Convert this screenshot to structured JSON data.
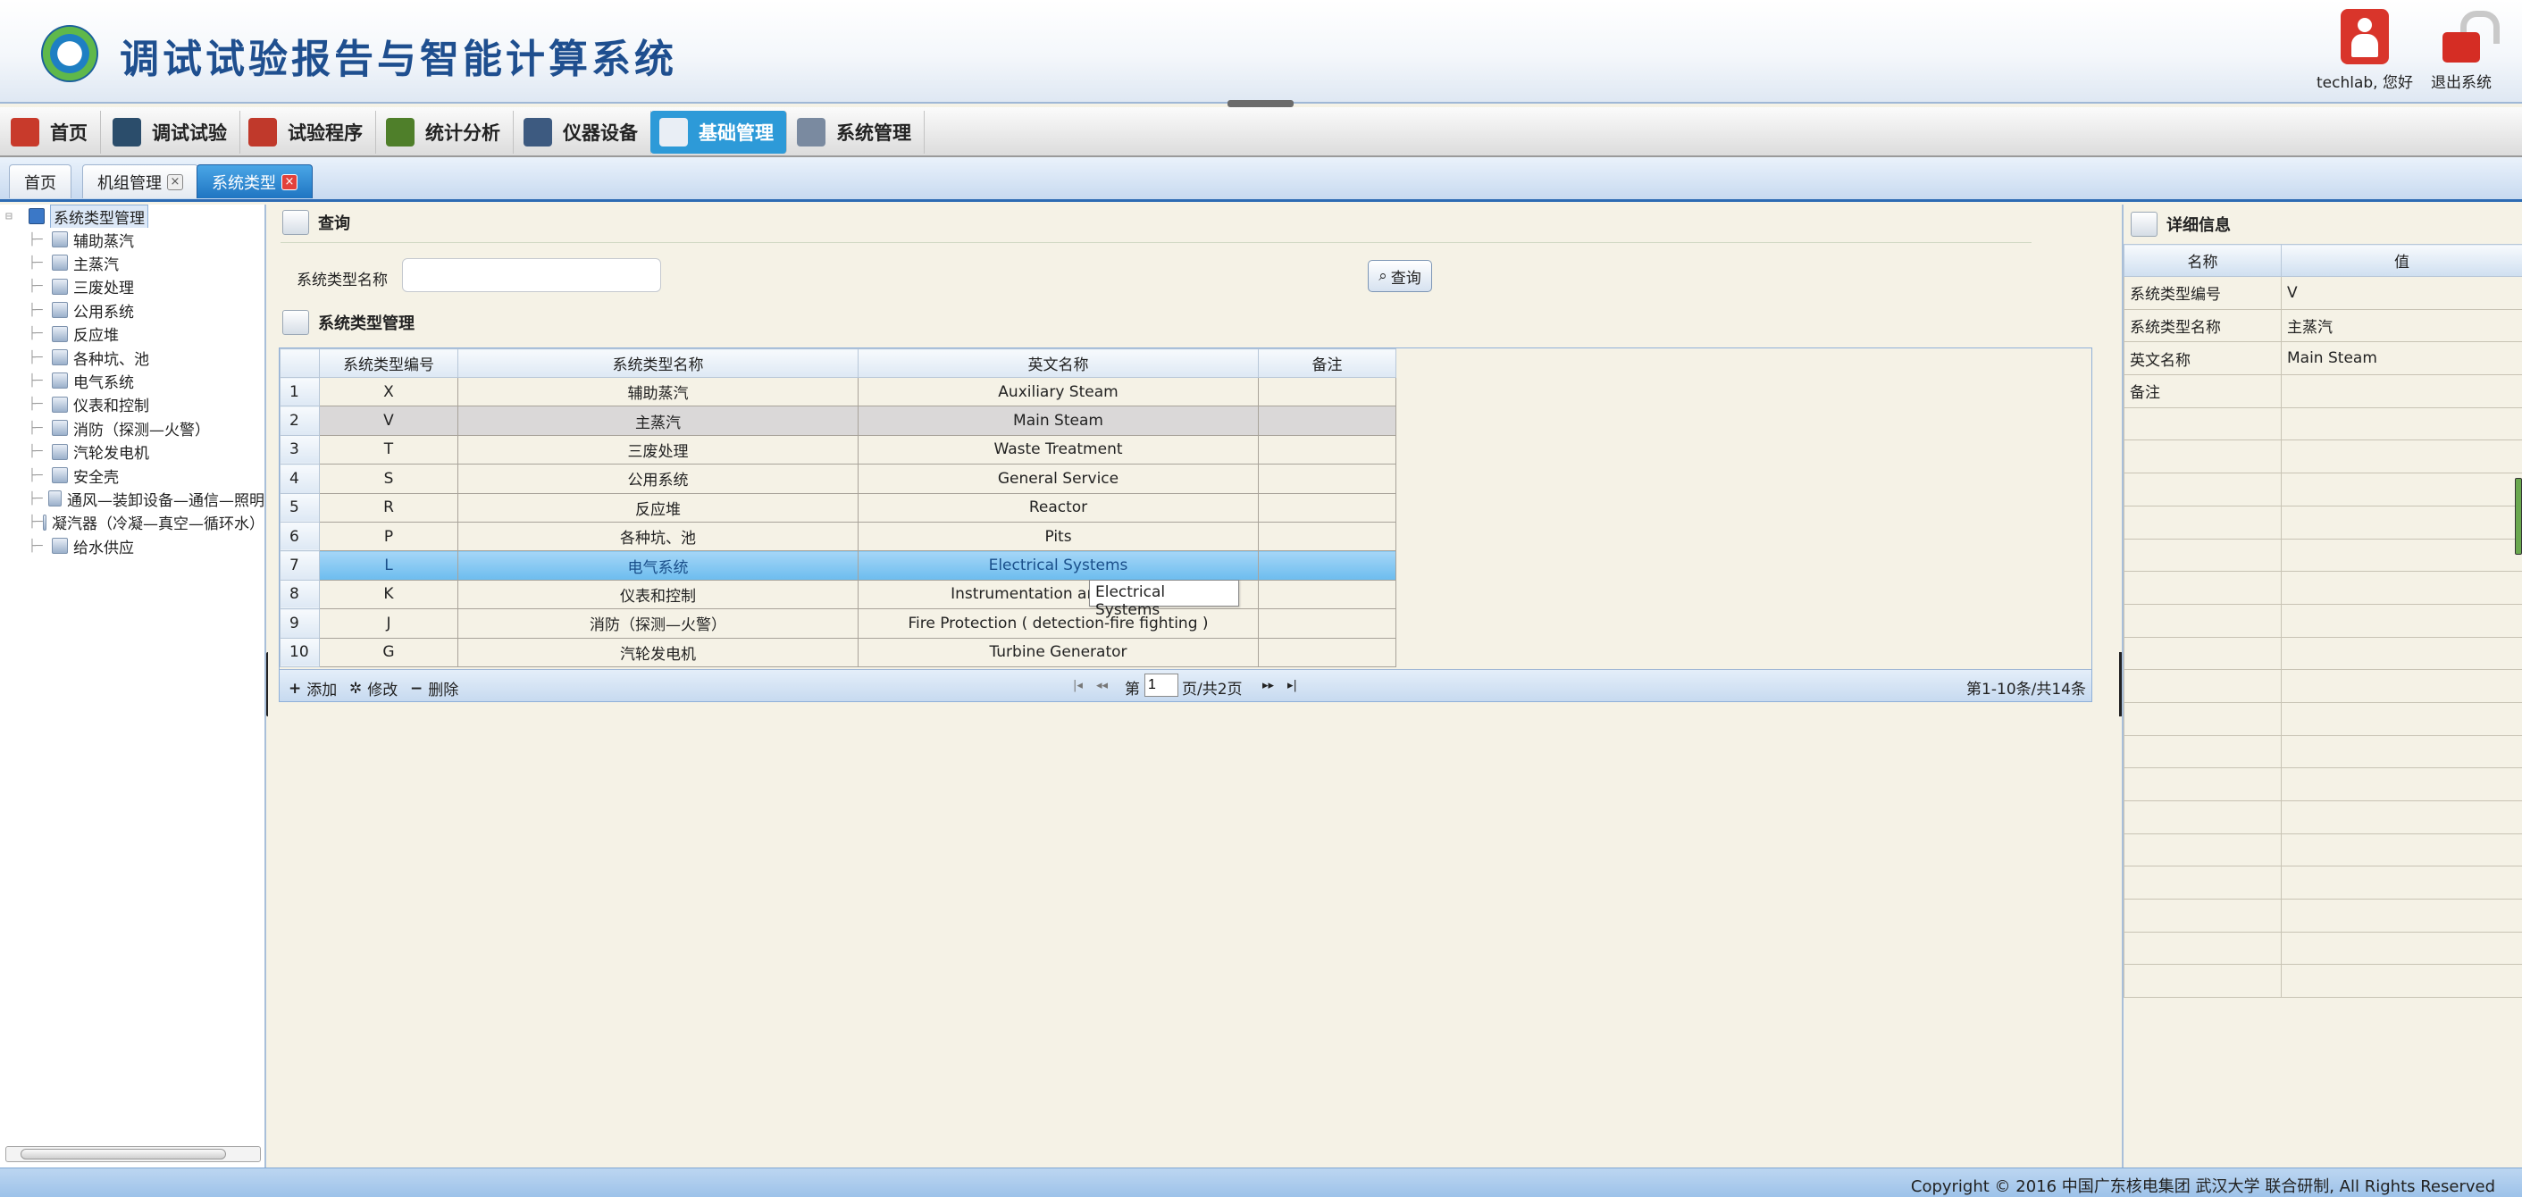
{
  "header": {
    "app_title": "调试试验报告与智能计算系统",
    "user_label": "techlab, 您好",
    "logout_label": "退出系统"
  },
  "nav": {
    "items": [
      {
        "label": "首页",
        "icon": "home-icon",
        "color": "#c83a2b"
      },
      {
        "label": "调试试验",
        "icon": "gauge-icon",
        "color": "#2b4d6b"
      },
      {
        "label": "试验程序",
        "icon": "hierarchy-icon",
        "color": "#c0392b"
      },
      {
        "label": "统计分析",
        "icon": "bar-chart-icon",
        "color": "#4f7f2a"
      },
      {
        "label": "仪器设备",
        "icon": "books-icon",
        "color": "#3d5a80"
      },
      {
        "label": "基础管理",
        "icon": "foundation-icon",
        "color": "#e9eef5"
      },
      {
        "label": "系统管理",
        "icon": "window-icon",
        "color": "#7a8aa0"
      }
    ],
    "active_index": 5
  },
  "tabs": [
    {
      "label": "首页",
      "closable": false
    },
    {
      "label": "机组管理",
      "closable": true
    },
    {
      "label": "系统类型",
      "closable": true
    }
  ],
  "tree": {
    "root": "系统类型管理",
    "children": [
      "辅助蒸汽",
      "主蒸汽",
      "三废处理",
      "公用系统",
      "反应堆",
      "各种坑、池",
      "电气系统",
      "仪表和控制",
      "消防（探测—火警）",
      "汽轮发电机",
      "安全壳",
      "通风—装卸设备—通信—照明",
      "凝汽器（冷凝—真空—循环水）",
      "给水供应"
    ]
  },
  "query": {
    "title": "查询",
    "field_label": "系统类型名称",
    "field_value": "",
    "button_label": "查询"
  },
  "grid": {
    "title": "系统类型管理",
    "columns": [
      "系统类型编号",
      "系统类型名称",
      "英文名称",
      "备注"
    ],
    "rows": [
      {
        "no": "1",
        "code": "X",
        "name": "辅助蒸汽",
        "en": "Auxiliary Steam",
        "remark": ""
      },
      {
        "no": "2",
        "code": "V",
        "name": "主蒸汽",
        "en": "Main Steam",
        "remark": ""
      },
      {
        "no": "3",
        "code": "T",
        "name": "三废处理",
        "en": "Waste Treatment",
        "remark": ""
      },
      {
        "no": "4",
        "code": "S",
        "name": "公用系统",
        "en": "General Service",
        "remark": ""
      },
      {
        "no": "5",
        "code": "R",
        "name": "反应堆",
        "en": "Reactor",
        "remark": ""
      },
      {
        "no": "6",
        "code": "P",
        "name": "各种坑、池",
        "en": "Pits",
        "remark": ""
      },
      {
        "no": "7",
        "code": "L",
        "name": "电气系统",
        "en": "Electrical Systems",
        "remark": ""
      },
      {
        "no": "8",
        "code": "K",
        "name": "仪表和控制",
        "en": "Instrumentation and Control",
        "remark": ""
      },
      {
        "no": "9",
        "code": "J",
        "name": "消防（探测—火警）",
        "en": "Fire Protection ( detection-fire fighting )",
        "remark": ""
      },
      {
        "no": "10",
        "code": "G",
        "name": "汽轮发电机",
        "en": "Turbine Generator",
        "remark": ""
      }
    ],
    "selected_row": 1,
    "hover_row": 6,
    "tooltip": "Electrical Systems",
    "toolbar": {
      "add": "添加",
      "edit": "修改",
      "delete": "删除"
    },
    "pager": {
      "page_prefix": "第",
      "page_value": "1",
      "page_suffix": "页/共2页",
      "summary": "第1-10条/共14条"
    }
  },
  "detail": {
    "title": "详细信息",
    "columns": [
      "名称",
      "值"
    ],
    "rows": [
      {
        "name": "系统类型编号",
        "value": "V"
      },
      {
        "name": "系统类型名称",
        "value": "主蒸汽"
      },
      {
        "name": "英文名称",
        "value": "Main Steam"
      },
      {
        "name": "备注",
        "value": ""
      }
    ]
  },
  "footer": {
    "copyright": "Copyright © 2016 中国广东核电集团 武汉大学 联合研制, All Rights Reserved"
  }
}
